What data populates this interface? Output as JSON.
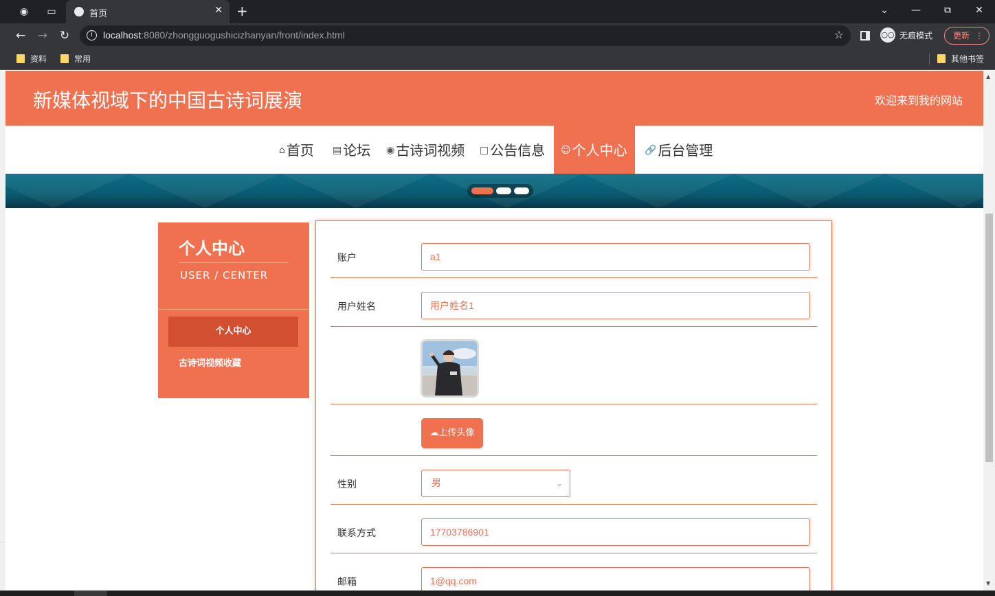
{
  "browser": {
    "tab_title": "首页",
    "url_host": "localhost",
    "url_rest": ":8080/zhongguogushicizhanyan/front/index.html",
    "incognito_label": "无痕模式",
    "update_label": "更新",
    "bookmarks": [
      "资料",
      "常用"
    ],
    "other_bookmarks": "其他书签"
  },
  "site": {
    "title": "新媒体视域下的中国古诗词展演",
    "welcome": "欢迎来到我的网站",
    "accent_color": "#f07150"
  },
  "nav": {
    "items": [
      {
        "label": "首页",
        "icon": "home-icon"
      },
      {
        "label": "论坛",
        "icon": "forum-icon"
      },
      {
        "label": "古诗词视频",
        "icon": "globe-icon"
      },
      {
        "label": "公告信息",
        "icon": "notice-icon"
      },
      {
        "label": "个人中心",
        "icon": "user-icon",
        "active": true
      },
      {
        "label": "后台管理",
        "icon": "link-icon"
      }
    ]
  },
  "carousel": {
    "slide_count": 3,
    "active_index": 0
  },
  "user_center": {
    "title": "个人中心",
    "subtitle": "USER / CENTER",
    "menu": [
      "个人中心",
      "古诗词视频收藏"
    ]
  },
  "form": {
    "account_label": "账户",
    "account_value": "a1",
    "name_label": "用户姓名",
    "name_value": "用户姓名1",
    "upload_label": "上传头像",
    "gender_label": "性别",
    "gender_value": "男",
    "phone_label": "联系方式",
    "phone_value": "17703786901",
    "email_label": "邮箱",
    "email_value": "1@qq.com"
  }
}
